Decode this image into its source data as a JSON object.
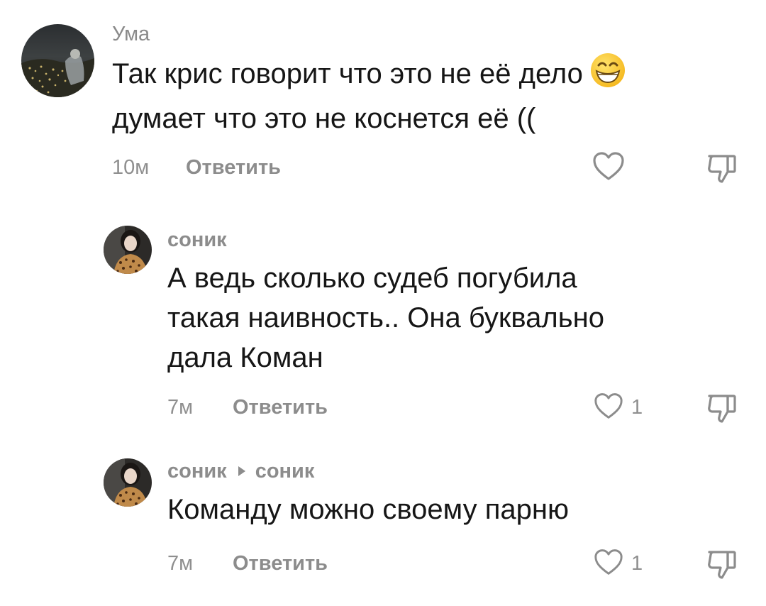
{
  "comments": [
    {
      "author": "Ума",
      "lines": [
        "Так крис говорит что это не её дело",
        "думает что это не коснется её (("
      ],
      "emoji": "grinning-face-emoji",
      "time": "10м",
      "reply_label": "Ответить",
      "likes": ""
    },
    {
      "author": "соник",
      "lines": [
        "А ведь сколько судеб погубила",
        "такая наивность.. Она буквально",
        "дала Коман"
      ],
      "time": "7м",
      "reply_label": "Ответить",
      "likes": "1"
    },
    {
      "author": "соник",
      "reply_to": "соник",
      "lines": [
        "Команду можно своему парню"
      ],
      "time": "7м",
      "reply_label": "Ответить",
      "likes": "1"
    }
  ],
  "icons": {
    "like": "heart-outline-icon",
    "dislike": "thumbs-down-outline-icon"
  },
  "colors": {
    "text": "#161616",
    "muted": "#8c8c8c",
    "background": "#ffffff"
  }
}
